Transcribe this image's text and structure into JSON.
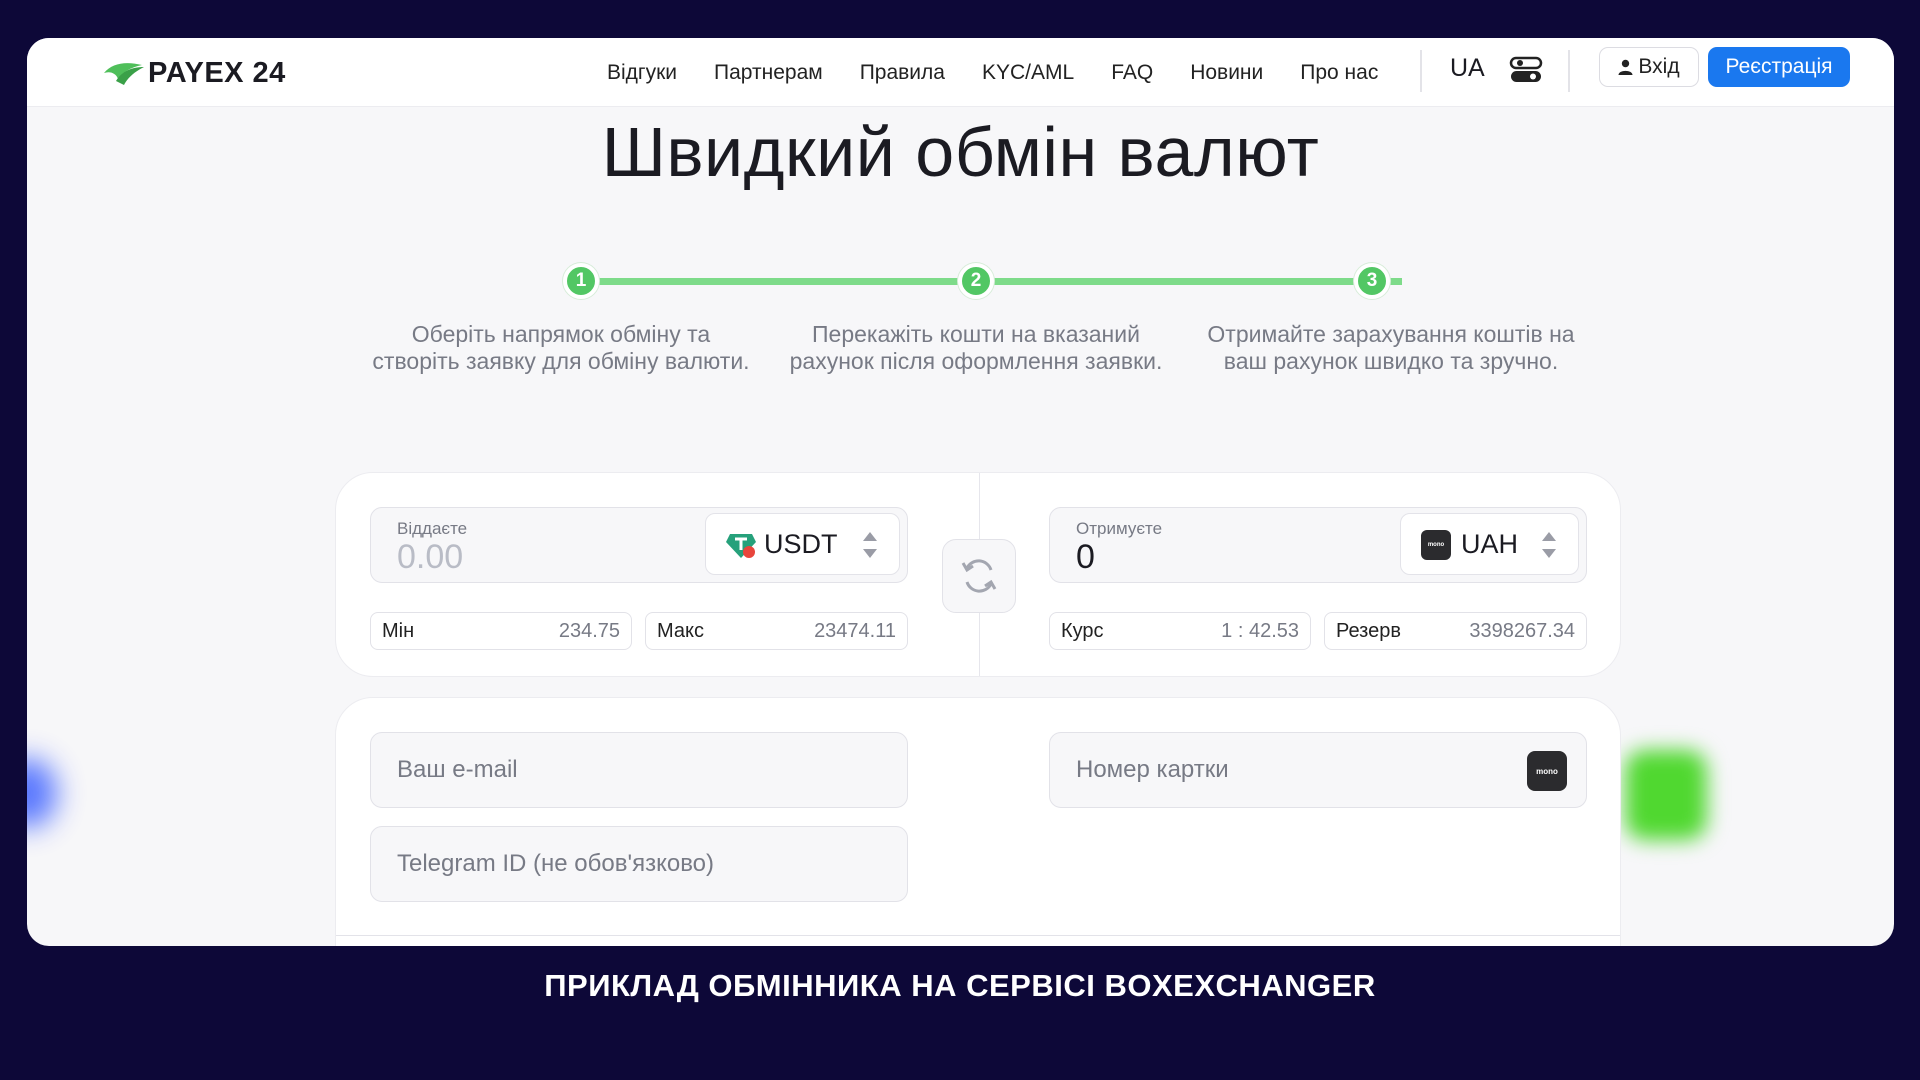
{
  "header": {
    "logo_text": "PAYEX 24",
    "nav": [
      "Відгуки",
      "Партнерам",
      "Правила",
      "KYC/AML",
      "FAQ",
      "Новини",
      "Про нас"
    ],
    "lang": "UA",
    "login_label": "Вхід",
    "register_label": "Реєстрація"
  },
  "hero": {
    "title": "Швидкий обмін валют"
  },
  "steps": [
    {
      "num": "1",
      "text": "Оберіть напрямок обміну та створіть заявку для обміну валюти."
    },
    {
      "num": "2",
      "text": "Перекажіть кошти на вказаний рахунок після оформлення заявки."
    },
    {
      "num": "3",
      "text": "Отримайте зарахування коштів на ваш рахунок швидко та зручно."
    }
  ],
  "give": {
    "label": "Віддаєте",
    "placeholder": "0.00",
    "currency": "USDT",
    "currency_icon": "tether-icon",
    "min_label": "Мін",
    "min_value": "234.75",
    "max_label": "Макс",
    "max_value": "23474.11"
  },
  "receive": {
    "label": "Отримуєте",
    "value": "0",
    "currency": "UAH",
    "currency_icon": "monobank-icon",
    "rate_label": "Курс",
    "rate_value": "1 : 42.53",
    "reserve_label": "Резерв",
    "reserve_value": "3398267.34"
  },
  "form": {
    "email_placeholder": "Ваш e-mail",
    "telegram_placeholder": "Telegram ID (не обов'язково)",
    "card_placeholder": "Номер картки",
    "mono_badge": "mono"
  },
  "caption": "ПРИКЛАД ОБМІННИКА НА СЕРВІСІ BOXEXCHANGER",
  "colors": {
    "accent_blue": "#1a78ef",
    "step_green": "#52c764",
    "background": "#0d0838"
  }
}
